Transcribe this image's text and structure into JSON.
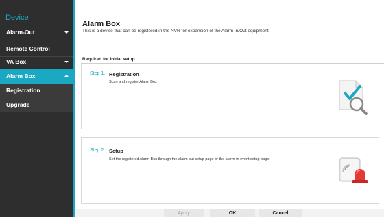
{
  "sidebar": {
    "title": "Device",
    "items": [
      {
        "label": "Alarm-Out",
        "caret": "down"
      },
      {
        "label": "Remote Control"
      },
      {
        "label": "VA Box",
        "caret": "down"
      },
      {
        "label": "Alarm Box",
        "caret": "up",
        "active": true
      },
      {
        "label": "Registration"
      },
      {
        "label": "Upgrade"
      }
    ]
  },
  "main": {
    "title": "Alarm Box",
    "description": "This is a device that can be registered in the NVR for expansion of the Alarm In/Out equipment.",
    "required_label": "Required for initial setup",
    "steps": [
      {
        "number": "Step 1.",
        "title": "Registration",
        "description": "Scan and register Alarm Box",
        "icon": "magnifier-check-icon"
      },
      {
        "number": "Step 2.",
        "title": "Setup",
        "description": "Set the registered Alarm Box through the alarm out setup page or the alarm-in event setup page.",
        "icon": "alarm-siren-icon"
      }
    ]
  },
  "footer": {
    "apply_label": "Apply",
    "ok_label": "OK",
    "cancel_label": "Cancel"
  },
  "colors": {
    "accent": "#1ba8c2",
    "sidebar_bg": "#2e2e2e",
    "alarm_red": "#e53935"
  }
}
